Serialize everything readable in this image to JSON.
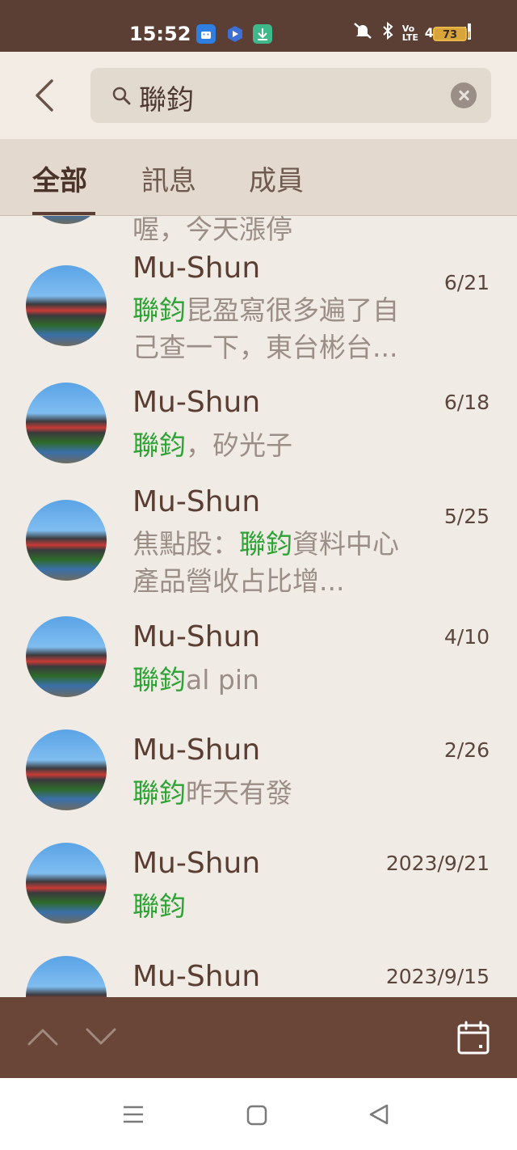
{
  "status_bar": {
    "time": "15:52",
    "battery": "73",
    "network": "4G",
    "volte": "Vo LTE",
    "icons": [
      "android-icon",
      "app-icon",
      "download-icon",
      "mute-icon",
      "bluetooth-icon",
      "signal-icon",
      "battery-icon"
    ]
  },
  "search": {
    "query": "聯鈞",
    "back_icon": "chevron-left-icon",
    "search_icon": "search-icon",
    "clear_icon": "close-icon"
  },
  "tabs": [
    {
      "label": "全部",
      "active": true
    },
    {
      "label": "訊息",
      "active": false
    },
    {
      "label": "成員",
      "active": false
    }
  ],
  "results": [
    {
      "name": "",
      "date": "",
      "before": "喔，今天漲停",
      "highlight": "",
      "after": ""
    },
    {
      "name": "Mu-Shun",
      "date": "6/21",
      "before": "",
      "highlight": "聯鈞",
      "after": "昆盈寫很多遍了自己查一下，東台彬台..."
    },
    {
      "name": "Mu-Shun",
      "date": "6/18",
      "before": "",
      "highlight": "聯鈞",
      "after": "，矽光子"
    },
    {
      "name": "Mu-Shun",
      "date": "5/25",
      "before": "焦點股：",
      "highlight": "聯鈞",
      "after": "資料中心產品營收占比增..."
    },
    {
      "name": "Mu-Shun",
      "date": "4/10",
      "before": "",
      "highlight": "聯鈞",
      "after": "al pin"
    },
    {
      "name": "Mu-Shun",
      "date": "2/26",
      "before": "",
      "highlight": "聯鈞",
      "after": "昨天有發"
    },
    {
      "name": "Mu-Shun",
      "date": "2023/9/21",
      "before": "",
      "highlight": "聯鈞",
      "after": ""
    },
    {
      "name": "Mu-Shun",
      "date": "2023/9/15",
      "before": "",
      "highlight": "",
      "after": ""
    }
  ],
  "colors": {
    "highlight": "#2ea335",
    "toolbar": "#6a4638",
    "status_bar": "#5b3f34"
  },
  "toolbar": {
    "icons": [
      "chevron-up-icon",
      "chevron-down-icon",
      "calendar-icon"
    ]
  },
  "nav_bar": {
    "icons": [
      "menu-icon",
      "home-icon",
      "back-icon"
    ]
  }
}
